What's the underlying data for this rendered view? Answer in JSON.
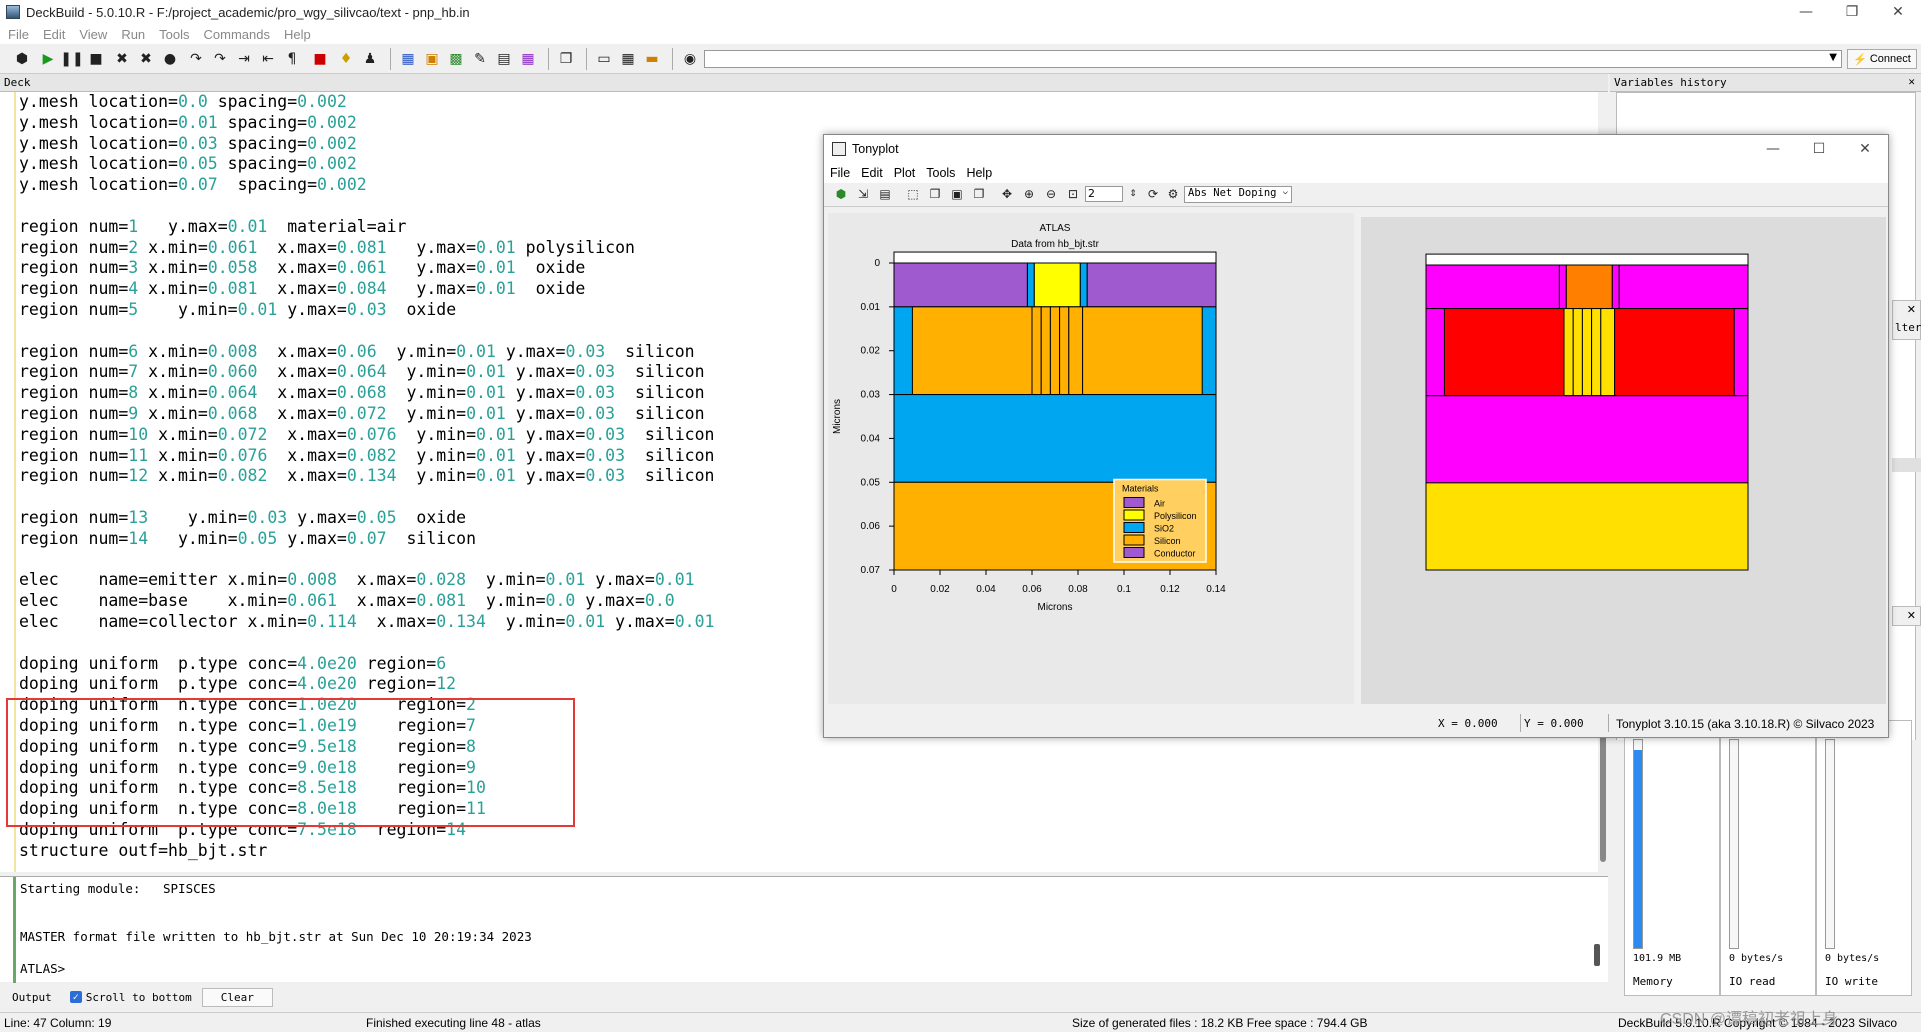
{
  "window": {
    "title": "DeckBuild - 5.0.10.R - F:/project_academic/pro_wgy_silivcao/text - pnp_hb.in",
    "minimize": "—",
    "maximize": "❐",
    "close": "✕"
  },
  "menu": [
    "File",
    "Edit",
    "View",
    "Run",
    "Tools",
    "Commands",
    "Help"
  ],
  "toolbar": {
    "connect_label": "Connect",
    "command_value": ""
  },
  "deck": {
    "header": "Deck",
    "lines": [
      "y.mesh location=0.0 spacing=0.002",
      "y.mesh location=0.01 spacing=0.002",
      "y.mesh location=0.03 spacing=0.002",
      "y.mesh location=0.05 spacing=0.002",
      "y.mesh location=0.07  spacing=0.002",
      "",
      "region num=1   y.max=0.01  material=air",
      "region num=2 x.min=0.061  x.max=0.081   y.max=0.01 polysilicon",
      "region num=3 x.min=0.058  x.max=0.061   y.max=0.01  oxide",
      "region num=4 x.min=0.081  x.max=0.084   y.max=0.01  oxide",
      "region num=5    y.min=0.01 y.max=0.03  oxide",
      "",
      "region num=6 x.min=0.008  x.max=0.06  y.min=0.01 y.max=0.03  silicon",
      "region num=7 x.min=0.060  x.max=0.064  y.min=0.01 y.max=0.03  silicon",
      "region num=8 x.min=0.064  x.max=0.068  y.min=0.01 y.max=0.03  silicon",
      "region num=9 x.min=0.068  x.max=0.072  y.min=0.01 y.max=0.03  silicon",
      "region num=10 x.min=0.072  x.max=0.076  y.min=0.01 y.max=0.03  silicon",
      "region num=11 x.min=0.076  x.max=0.082  y.min=0.01 y.max=0.03  silicon",
      "region num=12 x.min=0.082  x.max=0.134  y.min=0.01 y.max=0.03  silicon",
      "",
      "region num=13    y.min=0.03 y.max=0.05  oxide",
      "region num=14   y.min=0.05 y.max=0.07  silicon",
      "",
      "elec    name=emitter x.min=0.008  x.max=0.028  y.min=0.01 y.max=0.01",
      "elec    name=base    x.min=0.061  x.max=0.081  y.min=0.0 y.max=0.0",
      "elec    name=collector x.min=0.114  x.max=0.134  y.min=0.01 y.max=0.01",
      "",
      "doping uniform  p.type conc=4.0e20 region=6",
      "doping uniform  p.type conc=4.0e20 region=12",
      "doping uniform  n.type conc=1.0e20    region=2",
      "doping uniform  n.type conc=1.0e19    region=7",
      "doping uniform  n.type conc=9.5e18    region=8",
      "doping uniform  n.type conc=9.0e18    region=9",
      "doping uniform  n.type conc=8.5e18    region=10",
      "doping uniform  n.type conc=8.0e18    region=11",
      "doping uniform  p.type conc=7.5e18  region=14",
      "structure outf=hb_bjt.str"
    ]
  },
  "output": {
    "line1": "Starting module:   SPISCES",
    "line2": "MASTER format file written to hb_bjt.str at Sun Dec 10 20:19:34 2023",
    "line3": "ATLAS>",
    "tab_label": "Output",
    "scroll_label": "Scroll to bottom",
    "clear_label": "Clear"
  },
  "variables": {
    "header": "Variables history"
  },
  "meters": [
    {
      "value": "101.9 MB",
      "label": "Memory",
      "fill": 0.95
    },
    {
      "value": "0 bytes/s",
      "label": "IO read",
      "fill": 0
    },
    {
      "value": "0 bytes/s",
      "label": "IO write",
      "fill": 0
    }
  ],
  "side_partial": {
    "filter": "lter"
  },
  "status": {
    "position": "Line: 47 Column: 19",
    "message": "Finished executing line 48 - atlas",
    "files": "Size of generated files : 18.2 KB Free space : 794.4 GB",
    "copyright": "DeckBuild 5.0.10.R Copyright © 1984 - 2023 Silvaco",
    "watermark": "CSDN @谭稿初老祖上身"
  },
  "tonyplot": {
    "title": "Tonyplot",
    "menu": [
      "File",
      "Edit",
      "Plot",
      "Tools",
      "Help"
    ],
    "zoom_value": "2",
    "quantity": "Abs Net Doping",
    "coord_x": "X = 0.000",
    "coord_y": "Y = 0.000",
    "version": "Tonyplot 3.10.15 (aka 3.10.18.R) © Silvaco 2023"
  },
  "chart_data": [
    {
      "type": "structure",
      "title": "ATLAS",
      "subtitle": "Data from hb_bjt.str",
      "xlabel": "Microns",
      "ylabel": "Microns",
      "xlim": [
        0,
        0.14
      ],
      "ylim": [
        0,
        0.07
      ],
      "y_inverted": true,
      "xticks": [
        "0",
        "0.02",
        "0.04",
        "0.06",
        "0.08",
        "0.1",
        "0.12",
        "0.14"
      ],
      "yticks": [
        "0",
        "0.01",
        "0.02",
        "0.03",
        "0.04",
        "0.05",
        "0.06",
        "0.07"
      ],
      "legend": {
        "title": "Materials",
        "placement": "bottom-right",
        "entries": [
          {
            "name": "Air",
            "color": "#a05ad0"
          },
          {
            "name": "Polysilicon",
            "color": "#ffff00"
          },
          {
            "name": "SiO2",
            "color": "#00a6f0"
          },
          {
            "name": "Silicon",
            "color": "#ffb000"
          },
          {
            "name": "Conductor",
            "color": "#a05ad0"
          }
        ]
      },
      "regions": [
        {
          "x": [
            0,
            0.14
          ],
          "y": [
            -0.0025,
            0
          ],
          "fill": "#ffffff"
        },
        {
          "x": [
            0,
            0.058
          ],
          "y": [
            0,
            0.01
          ],
          "fill": "#a05ad0"
        },
        {
          "x": [
            0.058,
            0.061
          ],
          "y": [
            0,
            0.01
          ],
          "fill": "#00a6f0"
        },
        {
          "x": [
            0.061,
            0.081
          ],
          "y": [
            0,
            0.01
          ],
          "fill": "#ffff00"
        },
        {
          "x": [
            0.081,
            0.084
          ],
          "y": [
            0,
            0.01
          ],
          "fill": "#00a6f0"
        },
        {
          "x": [
            0.084,
            0.14
          ],
          "y": [
            0,
            0.01
          ],
          "fill": "#a05ad0"
        },
        {
          "x": [
            0,
            0.14
          ],
          "y": [
            0.01,
            0.03
          ],
          "fill": "#00a6f0"
        },
        {
          "x": [
            0.008,
            0.06
          ],
          "y": [
            0.01,
            0.03
          ],
          "fill": "#ffb000"
        },
        {
          "x": [
            0.06,
            0.064
          ],
          "y": [
            0.01,
            0.03
          ],
          "fill": "#ffb000"
        },
        {
          "x": [
            0.064,
            0.068
          ],
          "y": [
            0.01,
            0.03
          ],
          "fill": "#ffb000"
        },
        {
          "x": [
            0.068,
            0.072
          ],
          "y": [
            0.01,
            0.03
          ],
          "fill": "#ffb000"
        },
        {
          "x": [
            0.072,
            0.076
          ],
          "y": [
            0.01,
            0.03
          ],
          "fill": "#ffb000"
        },
        {
          "x": [
            0.076,
            0.082
          ],
          "y": [
            0.01,
            0.03
          ],
          "fill": "#ffb000"
        },
        {
          "x": [
            0.082,
            0.134
          ],
          "y": [
            0.01,
            0.03
          ],
          "fill": "#ffb000"
        },
        {
          "x": [
            0,
            0.14
          ],
          "y": [
            0.03,
            0.05
          ],
          "fill": "#00a6f0"
        },
        {
          "x": [
            0,
            0.14
          ],
          "y": [
            0.05,
            0.07
          ],
          "fill": "#ffb000"
        }
      ]
    },
    {
      "type": "structure",
      "quantity": "Abs Net Doping",
      "xlim": [
        0,
        0.14
      ],
      "ylim": [
        0,
        0.07
      ],
      "y_inverted": true,
      "regions": [
        {
          "x": [
            0,
            0.14
          ],
          "y": [
            -0.0025,
            0
          ],
          "fill": "#ffffff"
        },
        {
          "x": [
            0,
            0.058
          ],
          "y": [
            0,
            0.01
          ],
          "fill": "#ff00ff"
        },
        {
          "x": [
            0.058,
            0.061
          ],
          "y": [
            0,
            0.01
          ],
          "fill": "#ff00ff"
        },
        {
          "x": [
            0.061,
            0.081
          ],
          "y": [
            0,
            0.01
          ],
          "fill": "#ff8000"
        },
        {
          "x": [
            0.081,
            0.084
          ],
          "y": [
            0,
            0.01
          ],
          "fill": "#ff00ff"
        },
        {
          "x": [
            0.084,
            0.14
          ],
          "y": [
            0,
            0.01
          ],
          "fill": "#ff00ff"
        },
        {
          "x": [
            0,
            0.14
          ],
          "y": [
            0.01,
            0.03
          ],
          "fill": "#ff00ff"
        },
        {
          "x": [
            0.008,
            0.06
          ],
          "y": [
            0.01,
            0.03
          ],
          "fill": "#ff0000"
        },
        {
          "x": [
            0.06,
            0.064
          ],
          "y": [
            0.01,
            0.03
          ],
          "fill": "#ffe000"
        },
        {
          "x": [
            0.064,
            0.068
          ],
          "y": [
            0.01,
            0.03
          ],
          "fill": "#ffe000"
        },
        {
          "x": [
            0.068,
            0.072
          ],
          "y": [
            0.01,
            0.03
          ],
          "fill": "#ffe000"
        },
        {
          "x": [
            0.072,
            0.076
          ],
          "y": [
            0.01,
            0.03
          ],
          "fill": "#ffe000"
        },
        {
          "x": [
            0.076,
            0.082
          ],
          "y": [
            0.01,
            0.03
          ],
          "fill": "#ffe000"
        },
        {
          "x": [
            0.082,
            0.134
          ],
          "y": [
            0.01,
            0.03
          ],
          "fill": "#ff0000"
        },
        {
          "x": [
            0,
            0.14
          ],
          "y": [
            0.03,
            0.05
          ],
          "fill": "#ff00ff"
        },
        {
          "x": [
            0,
            0.14
          ],
          "y": [
            0.05,
            0.07
          ],
          "fill": "#ffe000"
        }
      ]
    }
  ]
}
